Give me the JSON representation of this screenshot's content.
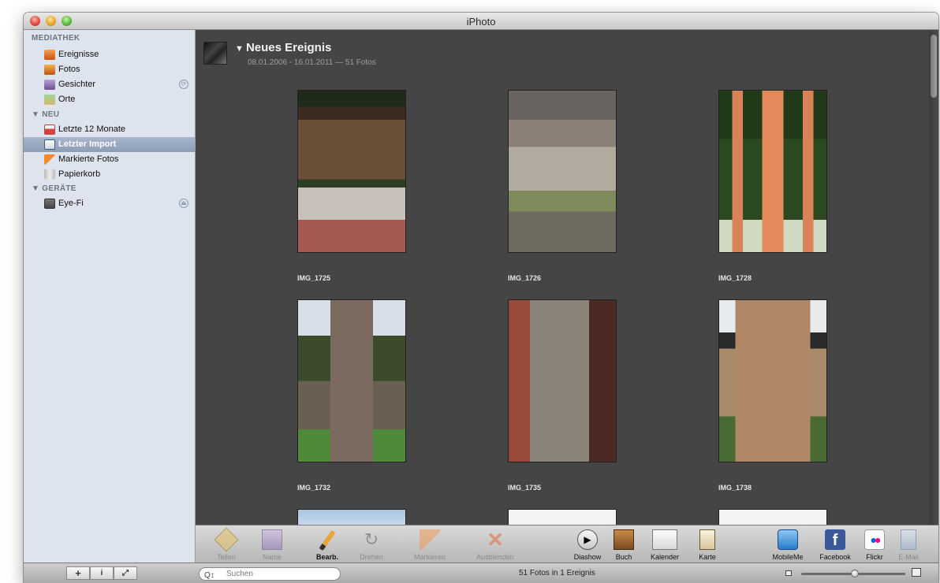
{
  "window": {
    "title": "iPhoto"
  },
  "sidebar": {
    "sections": [
      {
        "label": "MEDIATHEK"
      },
      {
        "label": "▼ NEU"
      },
      {
        "label": "▼ GERÄTE"
      }
    ],
    "items": [
      {
        "label": "Ereignisse",
        "icon": "events-icon"
      },
      {
        "label": "Fotos",
        "icon": "photos-icon"
      },
      {
        "label": "Gesichter",
        "icon": "faces-icon"
      },
      {
        "label": "Orte",
        "icon": "places-icon"
      },
      {
        "label": "Letzte 12 Monate",
        "icon": "calendar-icon"
      },
      {
        "label": "Letzter Import",
        "icon": "import-icon",
        "selected": true
      },
      {
        "label": "Markierte Fotos",
        "icon": "flag-icon"
      },
      {
        "label": "Papierkorb",
        "icon": "trash-icon"
      },
      {
        "label": "Eye-Fi",
        "icon": "card-icon"
      }
    ]
  },
  "event": {
    "title": "Neues Ereignis",
    "subtitle": "08.01.2006 - 16.01.2011 — 51 Fotos"
  },
  "photos": [
    {
      "name": "IMG_1725"
    },
    {
      "name": "IMG_1726"
    },
    {
      "name": "IMG_1728"
    },
    {
      "name": "IMG_1732"
    },
    {
      "name": "IMG_1735"
    },
    {
      "name": "IMG_1738"
    }
  ],
  "toolbar": {
    "tools": [
      {
        "label": "Teilen",
        "enabled": false
      },
      {
        "label": "Name",
        "enabled": false
      },
      {
        "label": "Bearb.",
        "enabled": true
      },
      {
        "label": "Drehen",
        "enabled": false
      },
      {
        "label": "Markieren",
        "enabled": false
      },
      {
        "label": "Ausblenden",
        "enabled": false
      },
      {
        "label": "Diashow",
        "enabled": true
      },
      {
        "label": "Buch",
        "enabled": true
      },
      {
        "label": "Kalender",
        "enabled": true
      },
      {
        "label": "Karte",
        "enabled": true
      },
      {
        "label": "MobileMe",
        "enabled": true
      },
      {
        "label": "Facebook",
        "enabled": true
      },
      {
        "label": "Flickr",
        "enabled": true
      },
      {
        "label": "E-Mail",
        "enabled": false
      }
    ]
  },
  "bottombar": {
    "add_label": "+",
    "info_label": "i",
    "fullscreen_label": "⤢",
    "search_placeholder": "Suchen",
    "status": "51 Fotos in 1 Ereignis",
    "zoom_level": 0.52
  },
  "colors": {
    "sidebar_bg": "#dde4ed",
    "content_bg": "#454545",
    "selection": "#8c9db6"
  }
}
